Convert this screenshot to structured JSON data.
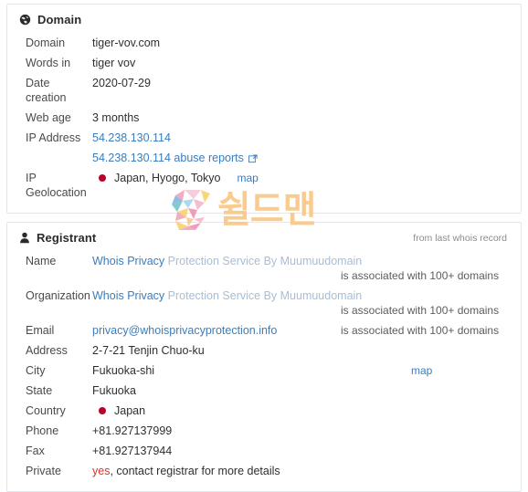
{
  "domain_card": {
    "title": "Domain",
    "icon": "globe-icon",
    "rows": [
      {
        "label": "Domain",
        "value": "tiger-vov.com",
        "type": "text"
      },
      {
        "label": "Words in",
        "value": "tiger vov",
        "type": "text"
      },
      {
        "label": "Date creation",
        "value": "2020-07-29",
        "type": "text"
      },
      {
        "label": "Web age",
        "value": "3 months",
        "type": "text"
      },
      {
        "label": "IP Address",
        "type": "links",
        "value": "54.238.130.114",
        "value2": "54.238.130.114 abuse reports",
        "value2_icon": "external-link-icon"
      },
      {
        "label": "IP Geolocation",
        "type": "geo",
        "value": "Japan, Hyogo, Tokyo",
        "flag_color": "#bc002d",
        "map_label": "map"
      }
    ]
  },
  "registrant_card": {
    "title": "Registrant",
    "icon": "user-icon",
    "header_note": "from last whois record",
    "rows": [
      {
        "label": "Name",
        "type": "split-link",
        "value_strong": "Whois Privacy",
        "value_soft": " Protection Service By Muumuudomain",
        "assoc": "is associated with 100+ domains"
      },
      {
        "label": "Organization",
        "type": "split-link",
        "value_strong": "Whois Privacy",
        "value_soft": " Protection Service By Muumuudomain",
        "assoc": "is associated with 100+ domains"
      },
      {
        "label": "Email",
        "type": "link-assoc",
        "value": "privacy@whoisprivacyprotection.info",
        "assoc": "is associated with 100+ domains"
      },
      {
        "label": "Address",
        "value": "2-7-21 Tenjin Chuo-ku",
        "type": "text"
      },
      {
        "label": "City",
        "value": "Fukuoka-shi",
        "type": "text-map",
        "map_label": "map"
      },
      {
        "label": "State",
        "value": "Fukuoka",
        "type": "text"
      },
      {
        "label": "Country",
        "value": "Japan",
        "type": "country",
        "flag_color": "#bc002d"
      },
      {
        "label": "Phone",
        "value": "+81.927137999",
        "type": "text"
      },
      {
        "label": "Fax",
        "value": "+81.927137944",
        "type": "text"
      },
      {
        "label": "Private",
        "type": "private",
        "value_red": "yes",
        "value_rest": ", contact registrar for more details"
      }
    ]
  },
  "watermark": {
    "logo": "faceted-s-logo",
    "text": "쉴드맨",
    "text_color": "#f9c98a"
  },
  "colors": {
    "link": "#3b7dbd",
    "link_soft": "#a9bdd4",
    "red": "#d9342b",
    "flag": "#bc002d",
    "border": "#e3e6ea"
  }
}
